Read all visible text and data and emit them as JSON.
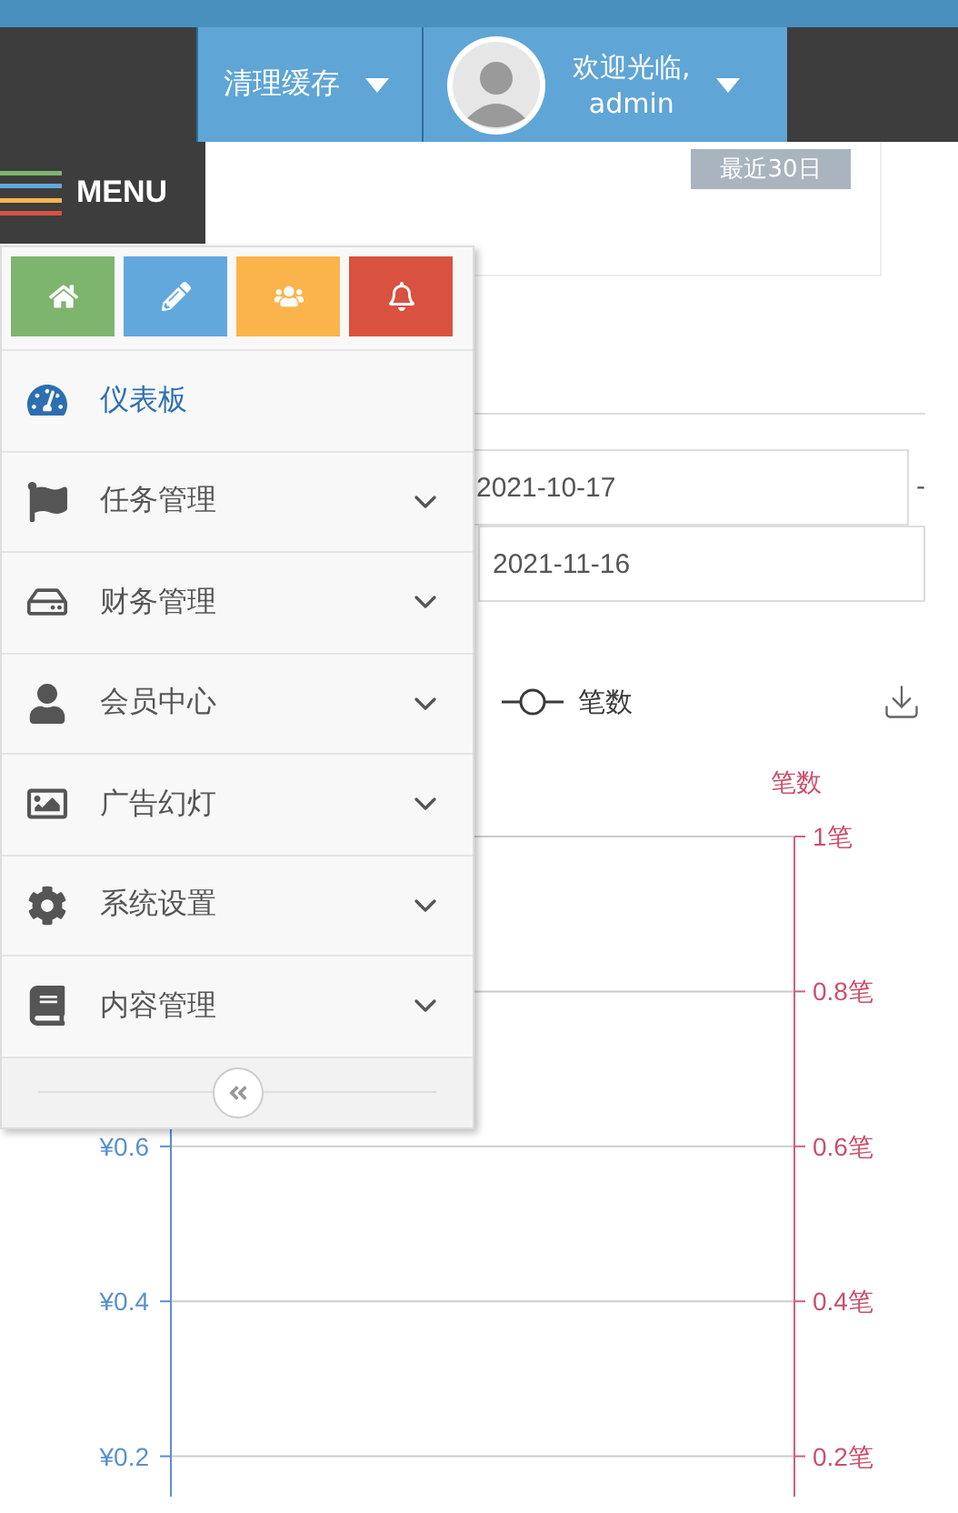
{
  "header": {
    "cache_button": {
      "label": "清理缓存"
    },
    "user": {
      "greeting": "欢迎光临,",
      "name": "admin"
    }
  },
  "menu_button": {
    "label": "MENU"
  },
  "sidebar": {
    "shortcuts": [
      {
        "kind": "home",
        "color": "#7db56f"
      },
      {
        "kind": "edit",
        "color": "#62a8dd"
      },
      {
        "kind": "users",
        "color": "#fbb44b"
      },
      {
        "kind": "bell",
        "color": "#d9513f"
      }
    ],
    "items": [
      {
        "kind": "dashboard",
        "label": "仪表板",
        "selected": true,
        "expandable": false
      },
      {
        "kind": "flag",
        "label": "任务管理",
        "selected": false,
        "expandable": true
      },
      {
        "kind": "drive",
        "label": "财务管理",
        "selected": false,
        "expandable": true
      },
      {
        "kind": "user",
        "label": "会员中心",
        "selected": false,
        "expandable": true
      },
      {
        "kind": "image",
        "label": "广告幻灯",
        "selected": false,
        "expandable": true
      },
      {
        "kind": "gear",
        "label": "系统设置",
        "selected": false,
        "expandable": true
      },
      {
        "kind": "book",
        "label": "内容管理",
        "selected": false,
        "expandable": true
      }
    ]
  },
  "content": {
    "range_button": {
      "label": "最近30日"
    },
    "date_from": "2021-10-17",
    "date_separator": "-",
    "date_to": "2021-11-16",
    "legend": [
      {
        "label": "笔数",
        "color": "#3a3a3a"
      }
    ],
    "chart": {
      "left_ticks": [
        "¥0.6",
        "¥0.4",
        "¥0.2"
      ],
      "right_title": "笔数",
      "right_ticks": [
        "1笔",
        "0.8笔",
        "0.6笔",
        "0.4笔",
        "0.2笔"
      ]
    }
  }
}
